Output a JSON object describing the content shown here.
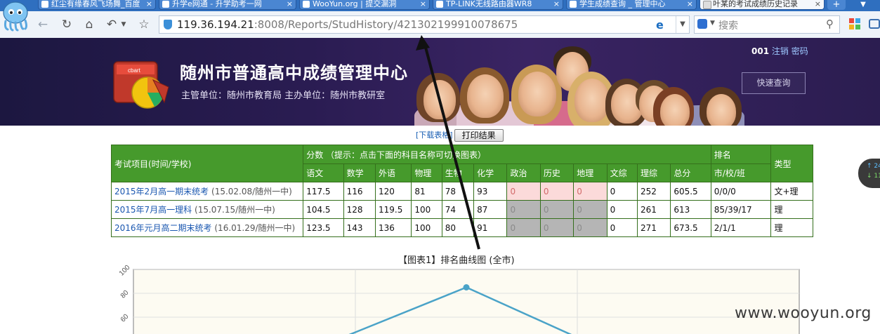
{
  "browser": {
    "tabs": [
      {
        "label": "红尘有缘春风飞场舞_百度",
        "active": false
      },
      {
        "label": "升学e网通 - 升学助考一网",
        "active": false
      },
      {
        "label": "WooYun.org | 提交漏洞",
        "active": false
      },
      {
        "label": "TP-LINK无线路由器WR8",
        "active": false
      },
      {
        "label": "学生成绩查询 _ 管理中心",
        "active": false
      },
      {
        "label": "叶某的考试成绩历史记录",
        "active": true
      }
    ],
    "new_tab_label": "+",
    "address": {
      "host": "119.36.194.21",
      "path": ":8008/Reports/StudHistory/421302199910078675"
    },
    "search_placeholder": "搜索"
  },
  "site": {
    "title": "随州市普通高中成绩管理中心",
    "subtitle": "主管单位：随州市教育局    主办单位：随州市教研室",
    "user_id": "001",
    "logout_label": "注销",
    "password_label": "密码",
    "quick_query_label": "快速查询",
    "logo_text": "cbart"
  },
  "actions": {
    "download_label": "[下载表格]",
    "print_label": "打印结果"
  },
  "table": {
    "exam_header": "考试项目(时间/学校)",
    "score_header": "分数  （提示：点击下面的科目名称可切换图表）",
    "rank_header": "排名",
    "type_header": "类型",
    "subjects": [
      "语文",
      "数学",
      "外语",
      "物理",
      "生物",
      "化学",
      "政治",
      "历史",
      "地理",
      "文综",
      "理综",
      "总分"
    ],
    "rank_sub": "市/校/班",
    "rows": [
      {
        "exam": "2015年2月高一期末统考",
        "meta": "(15.02.08/随州一中)",
        "scores": [
          "117.5",
          "116",
          "120",
          "81",
          "78",
          "93",
          "0",
          "0",
          "0",
          "0",
          "252",
          "605.5"
        ],
        "rank": "0/0/0",
        "type": "文+理"
      },
      {
        "exam": "2015年7月高一理科",
        "meta": "(15.07.15/随州一中)",
        "scores": [
          "104.5",
          "128",
          "119.5",
          "100",
          "74",
          "87",
          "0",
          "0",
          "0",
          "0",
          "261",
          "613"
        ],
        "rank": "85/39/17",
        "type": "理"
      },
      {
        "exam": "2016年元月高二期末统考",
        "meta": "(16.01.29/随州一中)",
        "scores": [
          "123.5",
          "143",
          "136",
          "100",
          "80",
          "91",
          "0",
          "0",
          "0",
          "0",
          "271",
          "673.5"
        ],
        "rank": "2/1/1",
        "type": "理"
      }
    ]
  },
  "chart_title": "【图表1】排名曲线图 (全市)",
  "chart_data": {
    "type": "line",
    "y_ticks": [
      "100",
      "80",
      "60"
    ],
    "ylim": [
      0,
      100
    ],
    "x_count": 3,
    "point_color": "#4aa3c8",
    "marker_value": 85
  },
  "widget": {
    "up": "↑ 24",
    "down": "↓ 11"
  },
  "watermark": "www.wooyun.org",
  "colors": {
    "header_green": "#469a2c",
    "banner_dark": "#2a1c52",
    "line_blue": "#4aa3c8"
  }
}
